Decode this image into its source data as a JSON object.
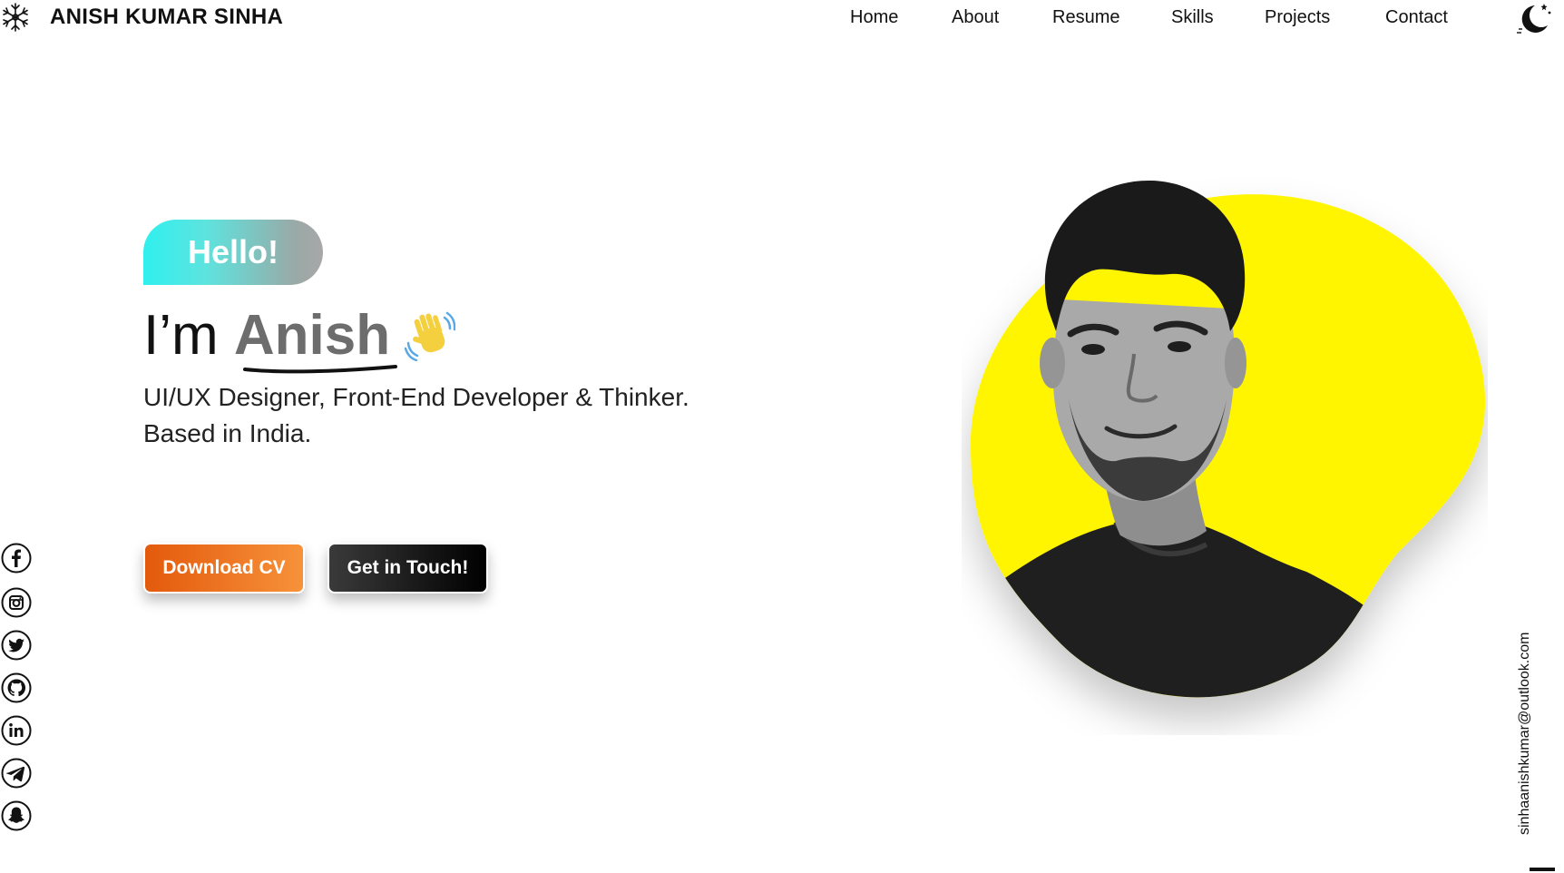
{
  "header": {
    "brand": "ANISH KUMAR SINHA",
    "logo_icon": "snowflake-icon",
    "theme_toggle_icon": "moon-icon"
  },
  "nav": {
    "items": [
      {
        "label": "Home"
      },
      {
        "label": "About"
      },
      {
        "label": "Resume"
      },
      {
        "label": "Skills"
      },
      {
        "label": "Projects"
      },
      {
        "label": "Contact"
      }
    ]
  },
  "hero": {
    "hello": "Hello!",
    "greeting_prefix": "I’m ",
    "name": "Anish",
    "wave_icon": "waving-hand-icon",
    "tagline_line1": "UI/UX Designer, Front-End Developer & Thinker.",
    "tagline_line2": "Based in India.",
    "download_cv": "Download CV",
    "get_in_touch": "Get in Touch!"
  },
  "social": [
    {
      "icon": "facebook-icon"
    },
    {
      "icon": "instagram-icon"
    },
    {
      "icon": "twitter-icon"
    },
    {
      "icon": "github-icon"
    },
    {
      "icon": "linkedin-icon"
    },
    {
      "icon": "telegram-icon"
    },
    {
      "icon": "snapchat-icon"
    }
  ],
  "email": "sinhaanishkumar@outlook.com",
  "colors": {
    "blob": "#fff500",
    "cv_button_start": "#e35a0c",
    "cv_button_end": "#f7923a",
    "touch_button_start": "#3a3a3a",
    "touch_button_end": "#000000",
    "hello_start": "#2ff0ee",
    "hello_end": "#a8a8a8",
    "name": "#6d6d6d"
  }
}
